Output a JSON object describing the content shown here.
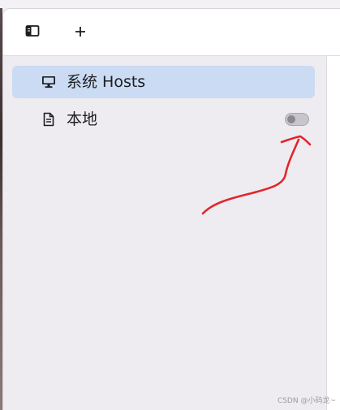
{
  "toolbar": {
    "sidebar_toggle_icon": "sidebar-panel-icon",
    "add_icon": "plus-icon",
    "add_label": "+"
  },
  "sidebar": {
    "items": [
      {
        "label": "系统 Hosts",
        "icon": "monitor-icon",
        "active": true
      },
      {
        "label": "本地",
        "icon": "document-icon",
        "active": false,
        "enabled": false
      }
    ]
  },
  "annotation": {
    "color": "#e0262b"
  },
  "colors": {
    "active_bg": "#cadbf3",
    "sidebar_bg": "#efecf1"
  },
  "watermark": "CSDN @小码龙~"
}
